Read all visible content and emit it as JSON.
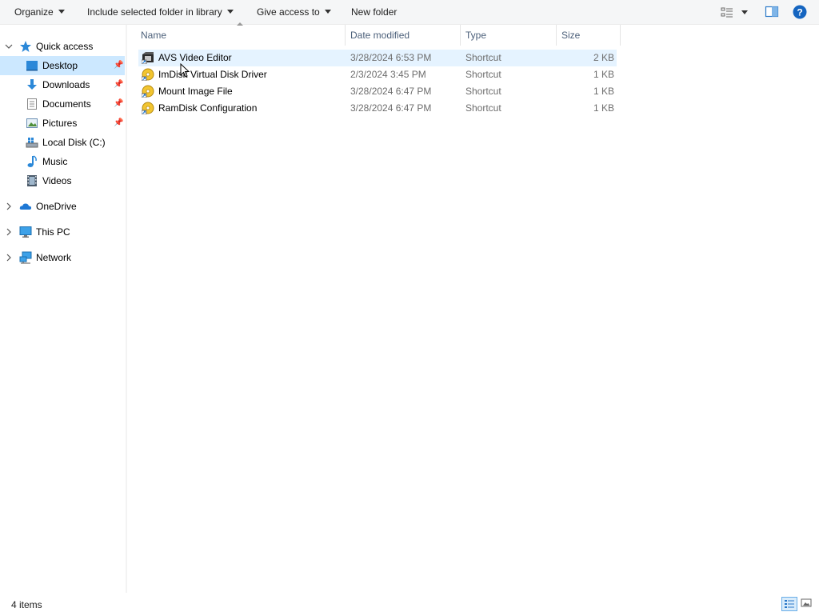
{
  "toolbar": {
    "organize": "Organize",
    "include_library": "Include selected folder in library",
    "give_access": "Give access to",
    "new_folder": "New folder"
  },
  "nav": {
    "quick_access": "Quick access",
    "items": [
      {
        "label": "Desktop",
        "icon": "desktop-icon",
        "pinned": true,
        "selected": true
      },
      {
        "label": "Downloads",
        "icon": "downloads-icon",
        "pinned": true
      },
      {
        "label": "Documents",
        "icon": "documents-icon",
        "pinned": true
      },
      {
        "label": "Pictures",
        "icon": "pictures-icon",
        "pinned": true
      },
      {
        "label": "Local Disk (C:)",
        "icon": "drive-icon"
      },
      {
        "label": "Music",
        "icon": "music-icon"
      },
      {
        "label": "Videos",
        "icon": "videos-icon"
      }
    ],
    "onedrive": "OneDrive",
    "this_pc": "This PC",
    "network": "Network"
  },
  "columns": {
    "name": "Name",
    "date": "Date modified",
    "type": "Type",
    "size": "Size"
  },
  "files": [
    {
      "name": "AVS Video Editor",
      "date": "3/28/2024 6:53 PM",
      "type": "Shortcut",
      "size": "2 KB",
      "icon": "video-editor-icon"
    },
    {
      "name": "ImDisk Virtual Disk Driver",
      "date": "2/3/2024 3:45 PM",
      "type": "Shortcut",
      "size": "1 KB",
      "icon": "imdisk-icon"
    },
    {
      "name": "Mount Image File",
      "date": "3/28/2024 6:47 PM",
      "type": "Shortcut",
      "size": "1 KB",
      "icon": "imdisk-icon"
    },
    {
      "name": "RamDisk Configuration",
      "date": "3/28/2024 6:47 PM",
      "type": "Shortcut",
      "size": "1 KB",
      "icon": "imdisk-icon"
    }
  ],
  "status": {
    "item_count": "4 items"
  },
  "colors": {
    "selection": "#cce8ff",
    "hover": "#e5f3ff",
    "header_text": "#4c607a"
  }
}
